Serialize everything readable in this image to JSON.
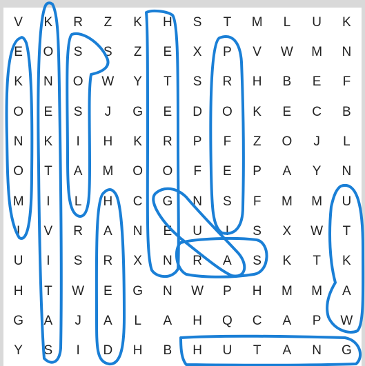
{
  "puzzle": {
    "grid": [
      [
        "V",
        "K",
        "R",
        "Z",
        "K",
        "H",
        "S",
        "T",
        "M",
        "L",
        "U",
        "K"
      ],
      [
        "E",
        "O",
        "S",
        "S",
        "Z",
        "E",
        "X",
        "P",
        "V",
        "W",
        "M",
        "N"
      ],
      [
        "K",
        "N",
        "O",
        "W",
        "Y",
        "T",
        "S",
        "R",
        "H",
        "B",
        "E",
        "F"
      ],
      [
        "O",
        "E",
        "S",
        "J",
        "G",
        "E",
        "D",
        "O",
        "K",
        "E",
        "C",
        "B"
      ],
      [
        "N",
        "K",
        "I",
        "H",
        "K",
        "R",
        "P",
        "F",
        "Z",
        "O",
        "J",
        "L"
      ],
      [
        "O",
        "T",
        "A",
        "M",
        "O",
        "O",
        "F",
        "E",
        "P",
        "A",
        "Y",
        "N"
      ],
      [
        "M",
        "I",
        "L",
        "H",
        "C",
        "G",
        "N",
        "S",
        "F",
        "M",
        "M",
        "U"
      ],
      [
        "I",
        "V",
        "R",
        "A",
        "N",
        "E",
        "U",
        "I",
        "S",
        "X",
        "W",
        "T"
      ],
      [
        "U",
        "I",
        "S",
        "R",
        "X",
        "N",
        "R",
        "A",
        "S",
        "K",
        "T",
        "K"
      ],
      [
        "H",
        "T",
        "W",
        "E",
        "G",
        "N",
        "W",
        "P",
        "H",
        "M",
        "M",
        "A"
      ],
      [
        "G",
        "A",
        "J",
        "A",
        "L",
        "A",
        "H",
        "Q",
        "C",
        "A",
        "P",
        "W"
      ],
      [
        "Y",
        "S",
        "I",
        "D",
        "H",
        "B",
        "H",
        "U",
        "T",
        "A",
        "N",
        "G"
      ]
    ],
    "stroke_color": "#1a7fd6",
    "background_color": "#d9d9d9"
  }
}
